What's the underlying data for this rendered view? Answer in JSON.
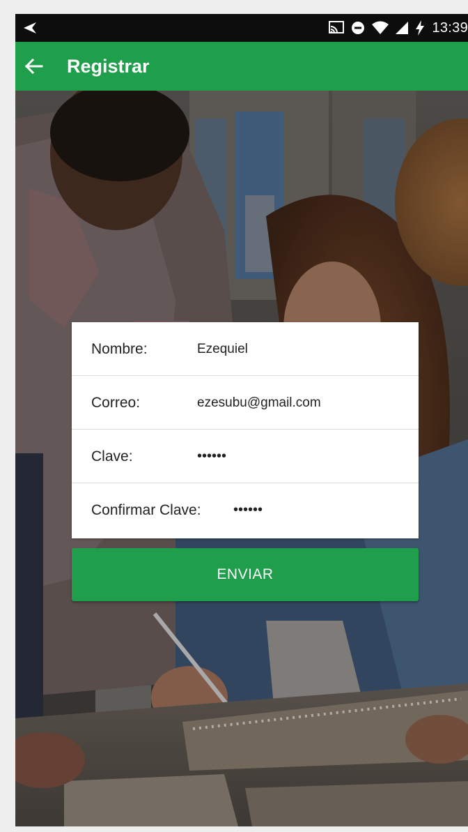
{
  "status_bar": {
    "time": "13:39"
  },
  "app_bar": {
    "title": "Registrar"
  },
  "form": {
    "fields": [
      {
        "label": "Nombre:",
        "value": "Ezequiel"
      },
      {
        "label": "Correo:",
        "value": "ezesubu@gmail.com"
      },
      {
        "label": "Clave:",
        "value": "••••••"
      },
      {
        "label": "Confirmar Clave:",
        "value": "••••••"
      }
    ],
    "submit_label": "ENVIAR"
  },
  "colors": {
    "primary": "#1f9e4b",
    "status_bar": "#0d0d0d",
    "card": "#ffffff"
  },
  "icons": {
    "status_nav": "send-arrow-icon",
    "cast": "cast-icon",
    "dnd": "do-not-disturb-icon",
    "wifi": "wifi-icon",
    "signal": "signal-icon",
    "battery": "battery-charging-icon",
    "back": "back-arrow-icon"
  }
}
